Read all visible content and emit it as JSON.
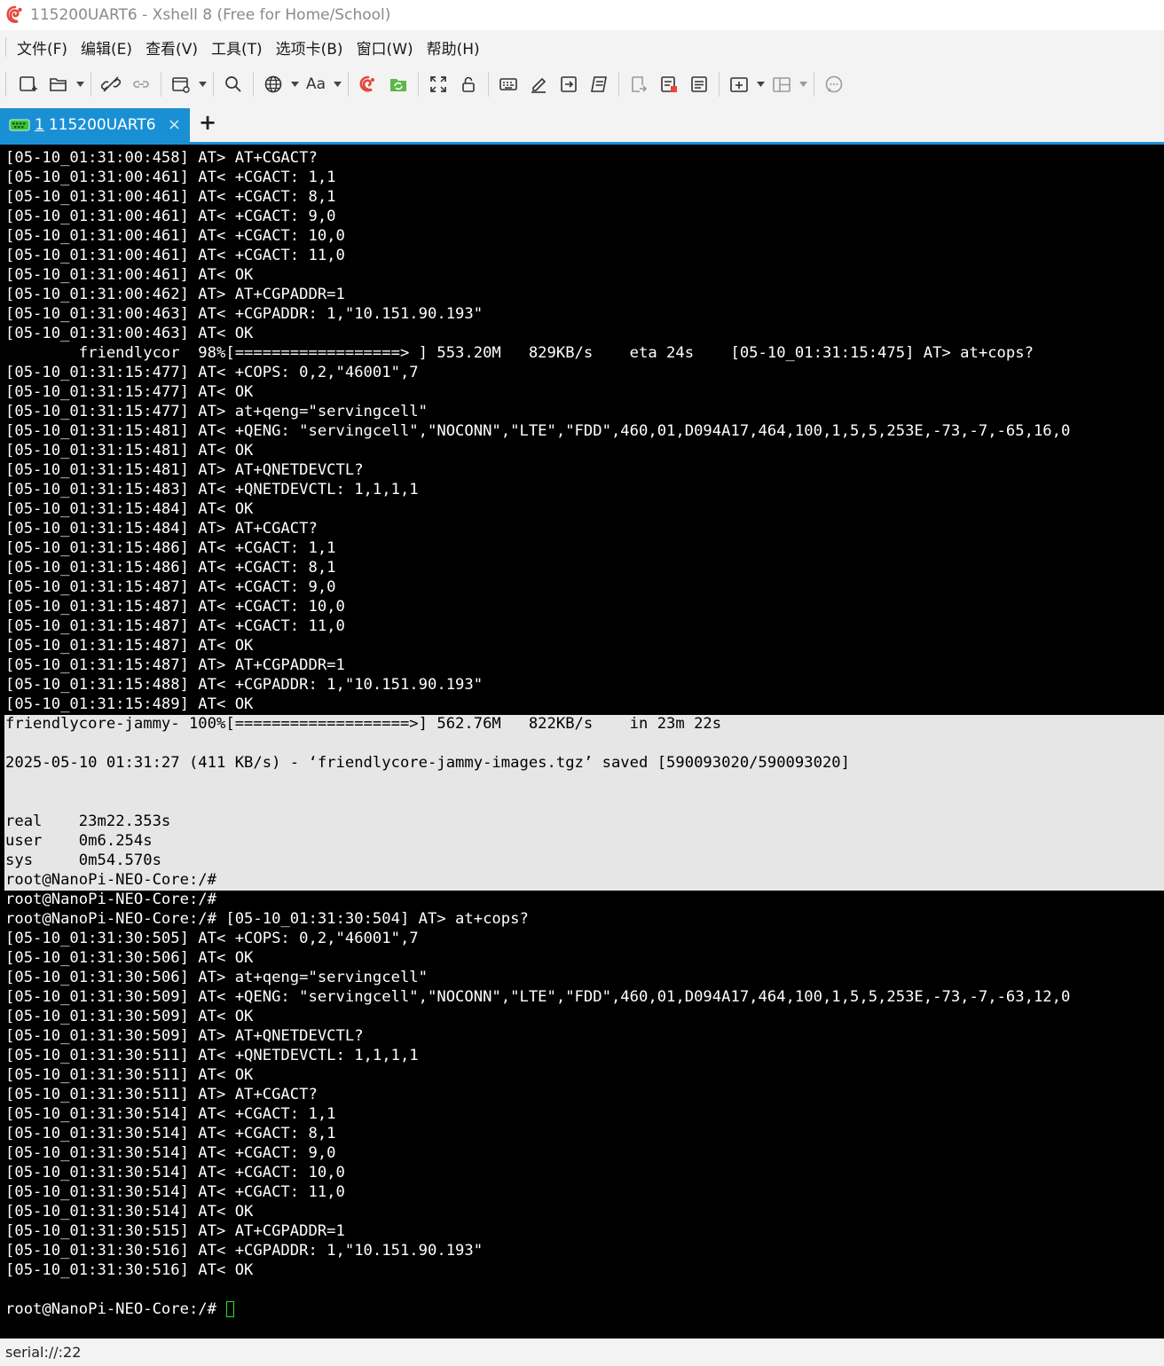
{
  "window": {
    "title": "115200UART6 - Xshell 8 (Free for Home/School)",
    "brand_color": "#e5473a"
  },
  "menu": [
    {
      "label": "文件(F)"
    },
    {
      "label": "编辑(E)"
    },
    {
      "label": "查看(V)"
    },
    {
      "label": "工具(T)"
    },
    {
      "label": "选项卡(B)"
    },
    {
      "label": "窗口(W)"
    },
    {
      "label": "帮助(H)"
    }
  ],
  "toolbar": {
    "font_button_label": "Aa",
    "icons": [
      "new-session-icon",
      "open-folder-icon",
      "disconnect-icon",
      "link-icon",
      "new-window-icon",
      "search-icon",
      "globe-icon",
      "font-icon",
      "xshell-icon",
      "xftp-icon",
      "fullscreen-icon",
      "lock-icon",
      "keyboard-icon",
      "highlight-icon",
      "send-icon",
      "script-icon",
      "log-icon",
      "record-icon",
      "compose-icon",
      "add-tab-icon",
      "layout-icon",
      "chat-icon"
    ]
  },
  "tab": {
    "number": "1",
    "label": "115200UART6",
    "close_glyph": "×",
    "add_glyph": "+",
    "accent_color": "#1a90d4"
  },
  "terminal": {
    "lines": [
      "[05-10_01:31:00:458] AT> AT+CGACT?",
      "[05-10_01:31:00:461] AT< +CGACT: 1,1",
      "[05-10_01:31:00:461] AT< +CGACT: 8,1",
      "[05-10_01:31:00:461] AT< +CGACT: 9,0",
      "[05-10_01:31:00:461] AT< +CGACT: 10,0",
      "[05-10_01:31:00:461] AT< +CGACT: 11,0",
      "[05-10_01:31:00:461] AT< OK",
      "[05-10_01:31:00:462] AT> AT+CGPADDR=1",
      "[05-10_01:31:00:463] AT< +CGPADDR: 1,\"10.151.90.193\"",
      "[05-10_01:31:00:463] AT< OK",
      "        friendlycor  98%[==================> ] 553.20M   829KB/s    eta 24s    [05-10_01:31:15:475] AT> at+cops?",
      "[05-10_01:31:15:477] AT< +COPS: 0,2,\"46001\",7",
      "[05-10_01:31:15:477] AT< OK",
      "[05-10_01:31:15:477] AT> at+qeng=\"servingcell\"",
      "[05-10_01:31:15:481] AT< +QENG: \"servingcell\",\"NOCONN\",\"LTE\",\"FDD\",460,01,D094A17,464,100,1,5,5,253E,-73,-7,-65,16,0",
      "[05-10_01:31:15:481] AT< OK",
      "[05-10_01:31:15:481] AT> AT+QNETDEVCTL?",
      "[05-10_01:31:15:483] AT< +QNETDEVCTL: 1,1,1,1",
      "[05-10_01:31:15:484] AT< OK",
      "[05-10_01:31:15:484] AT> AT+CGACT?",
      "[05-10_01:31:15:486] AT< +CGACT: 1,1",
      "[05-10_01:31:15:486] AT< +CGACT: 8,1",
      "[05-10_01:31:15:487] AT< +CGACT: 9,0",
      "[05-10_01:31:15:487] AT< +CGACT: 10,0",
      "[05-10_01:31:15:487] AT< +CGACT: 11,0",
      "[05-10_01:31:15:487] AT< OK",
      "[05-10_01:31:15:487] AT> AT+CGPADDR=1",
      "[05-10_01:31:15:488] AT< +CGPADDR: 1,\"10.151.90.193\"",
      "[05-10_01:31:15:489] AT< OK",
      "friendlycore-jammy- 100%[===================>] 562.76M   822KB/s    in 23m 22s",
      "",
      "2025-05-10 01:31:27 (411 KB/s) - ‘friendlycore-jammy-images.tgz’ saved [590093020/590093020]",
      "",
      "",
      "real\t23m22.353s",
      "user\t0m6.254s",
      "sys\t0m54.570s",
      "root@NanoPi-NEO-Core:/#",
      "root@NanoPi-NEO-Core:/#",
      "root@NanoPi-NEO-Core:/# [05-10_01:31:30:504] AT> at+cops?",
      "[05-10_01:31:30:505] AT< +COPS: 0,2,\"46001\",7",
      "[05-10_01:31:30:506] AT< OK",
      "[05-10_01:31:30:506] AT> at+qeng=\"servingcell\"",
      "[05-10_01:31:30:509] AT< +QENG: \"servingcell\",\"NOCONN\",\"LTE\",\"FDD\",460,01,D094A17,464,100,1,5,5,253E,-73,-7,-63,12,0",
      "[05-10_01:31:30:509] AT< OK",
      "[05-10_01:31:30:509] AT> AT+QNETDEVCTL?",
      "[05-10_01:31:30:511] AT< +QNETDEVCTL: 1,1,1,1",
      "[05-10_01:31:30:511] AT< OK",
      "[05-10_01:31:30:511] AT> AT+CGACT?",
      "[05-10_01:31:30:514] AT< +CGACT: 1,1",
      "[05-10_01:31:30:514] AT< +CGACT: 8,1",
      "[05-10_01:31:30:514] AT< +CGACT: 9,0",
      "[05-10_01:31:30:514] AT< +CGACT: 10,0",
      "[05-10_01:31:30:514] AT< +CGACT: 11,0",
      "[05-10_01:31:30:514] AT< OK",
      "[05-10_01:31:30:515] AT> AT+CGPADDR=1",
      "[05-10_01:31:30:516] AT< +CGPADDR: 1,\"10.151.90.193\"",
      "[05-10_01:31:30:516] AT< OK",
      "",
      "root@NanoPi-NEO-Core:/# "
    ],
    "cursor_color": "#2fe02f"
  },
  "status": {
    "text": "serial://:22"
  }
}
